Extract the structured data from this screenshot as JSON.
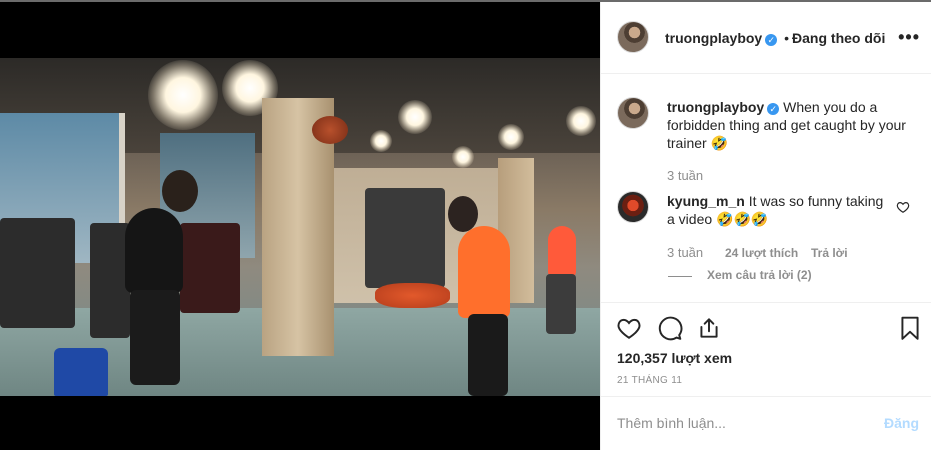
{
  "post": {
    "username": "truongplayboy",
    "separator": "•",
    "follow_status": "Đang theo dõi",
    "more_label": "•••"
  },
  "caption": {
    "username": "truongplayboy",
    "text": "When you do a forbidden thing and get caught by your trainer 🤣",
    "time": "3 tuần"
  },
  "comment": {
    "username": "kyung_m_n",
    "text": "It was so funny taking a video 🤣🤣🤣",
    "time": "3 tuần",
    "likes": "24 lượt thích",
    "reply": "Trả lời",
    "view_replies": "Xem câu trả lời (2)"
  },
  "stats": {
    "views": "120,357 lượt xem",
    "date": "21 THÁNG 11"
  },
  "add_comment": {
    "placeholder": "Thêm bình luận...",
    "post_label": "Đăng"
  },
  "colors": {
    "verified": "#3897f0",
    "post_button_disabled": "#b3dbff",
    "secondary_text": "#8e8e8e"
  },
  "icons": [
    "verified-badge-icon",
    "more-options-icon",
    "heart-icon",
    "comment-icon",
    "share-icon",
    "bookmark-icon",
    "small-heart-icon"
  ]
}
